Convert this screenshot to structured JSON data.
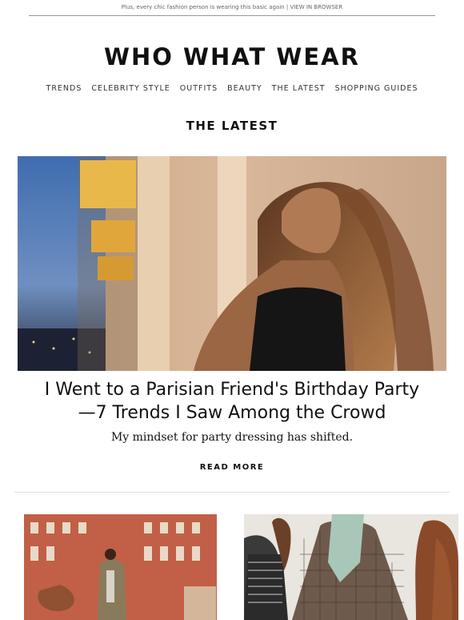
{
  "preheader": {
    "text": "Plus, every chic fashion person is wearing this basic again",
    "separator": "|",
    "view_in_browser": "VIEW IN BROWSER"
  },
  "brand": {
    "logo_text": "WHO WHAT WEAR"
  },
  "nav": {
    "items": [
      "TRENDS",
      "CELEBRITY STYLE",
      "OUTFITS",
      "BEAUTY",
      "THE LATEST",
      "SHOPPING GUIDES"
    ]
  },
  "section": {
    "title": "THE LATEST"
  },
  "feature": {
    "headline": "I Went to a Parisian Friend's Birthday Party— 7 Trends I Saw Among the Crowd",
    "headline_line1": "I Went to a Parisian Friend's Birthday Party",
    "headline_line2": "—7 Trends I Saw Among the Crowd",
    "dek": "My mindset for party dressing has shifted.",
    "cta": "READ MORE"
  },
  "colors": {
    "text": "#111111",
    "muted": "#666666",
    "divider": "#dddddd"
  }
}
